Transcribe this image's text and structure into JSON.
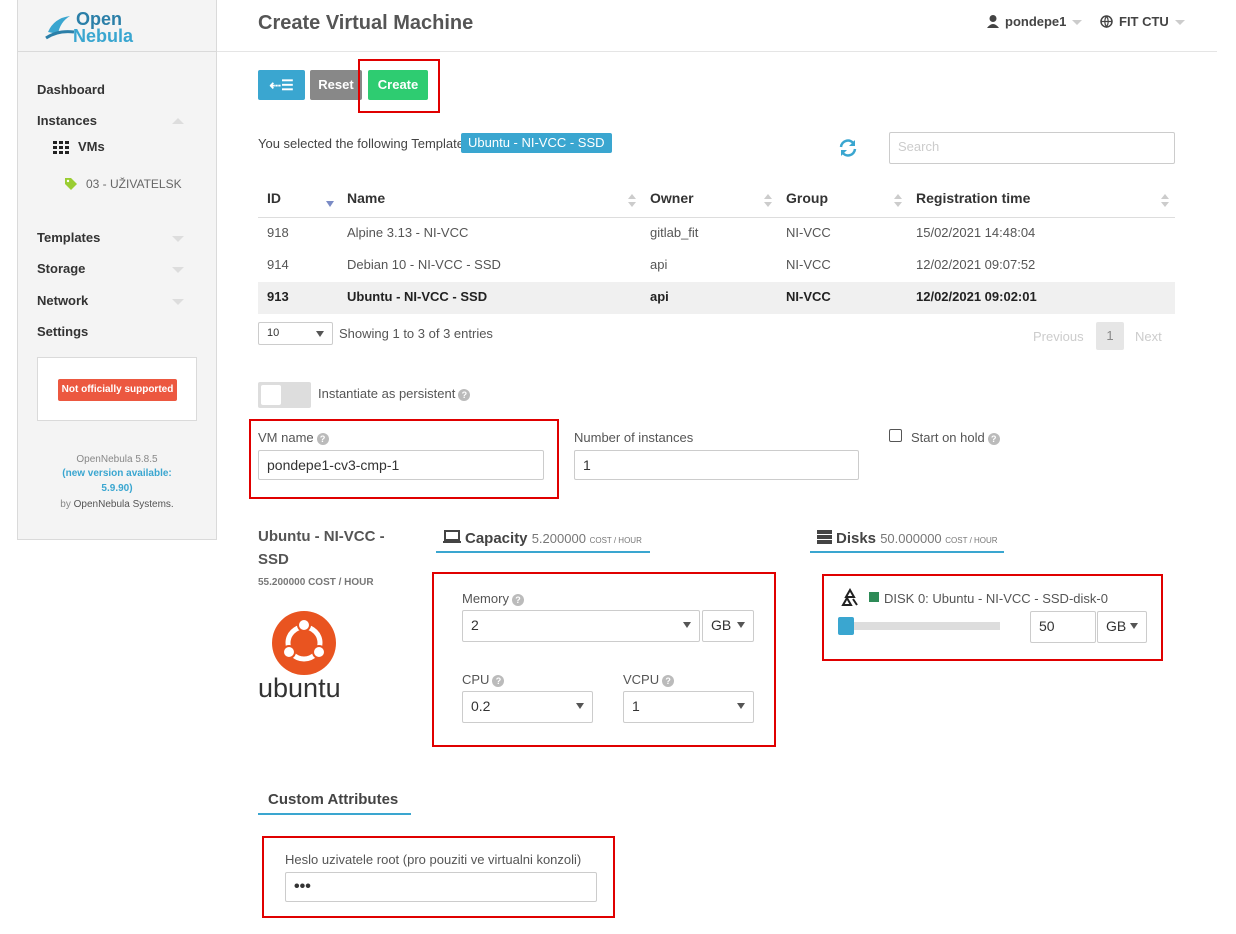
{
  "sidebar": {
    "logo_line1": "Open",
    "logo_line2": "Nebula",
    "items": [
      {
        "label": "Dashboard"
      },
      {
        "label": "Instances"
      },
      {
        "label": "VMs"
      },
      {
        "label": "03 - UŽIVATELSK"
      },
      {
        "label": "Templates"
      },
      {
        "label": "Storage"
      },
      {
        "label": "Network"
      },
      {
        "label": "Settings"
      }
    ],
    "support_badge": "Not officially supported",
    "version": "OpenNebula 5.8.5",
    "new_version_1": "(new version available:",
    "new_version_2": "5.9.90)",
    "by_prefix": "by",
    "by_company": "OpenNebula Systems."
  },
  "header": {
    "title": "Create Virtual Machine",
    "user": "pondepe1",
    "zone": "FIT CTU"
  },
  "toolbar": {
    "back_label": "⇠☰",
    "reset_label": "Reset",
    "create_label": "Create"
  },
  "template_select": {
    "prefix": "You selected the following Template:",
    "selected": "Ubuntu - NI-VCC - SSD",
    "search_placeholder": "Search"
  },
  "table": {
    "headers": [
      "ID",
      "Name",
      "Owner",
      "Group",
      "Registration time"
    ],
    "rows": [
      {
        "id": "918",
        "name": "Alpine 3.13 - NI-VCC",
        "owner": "gitlab_fit",
        "group": "NI-VCC",
        "time": "15/02/2021 14:48:04"
      },
      {
        "id": "914",
        "name": "Debian 10 - NI-VCC - SSD",
        "owner": "api",
        "group": "NI-VCC",
        "time": "12/02/2021 09:07:52"
      },
      {
        "id": "913",
        "name": "Ubuntu - NI-VCC - SSD",
        "owner": "api",
        "group": "NI-VCC",
        "time": "12/02/2021 09:02:01"
      }
    ],
    "page_length": "10",
    "info": "Showing 1 to 3 of 3 entries",
    "prev": "Previous",
    "page": "1",
    "next": "Next"
  },
  "form": {
    "persistent_label": "Instantiate as persistent",
    "vm_name_label": "VM name",
    "vm_name_value": "pondepe1-cv3-cmp-1",
    "instances_label": "Number of instances",
    "instances_value": "1",
    "hold_label": "Start on hold"
  },
  "template_info": {
    "name": "Ubuntu - NI-VCC - SSD",
    "cost": "55.200000",
    "cost_unit": "COST / HOUR",
    "logo_text": "ubuntu"
  },
  "capacity": {
    "title": "Capacity",
    "cost": "5.200000",
    "cost_unit": "COST / HOUR",
    "memory_label": "Memory",
    "memory_value": "2",
    "memory_unit": "GB",
    "cpu_label": "CPU",
    "cpu_value": "0.2",
    "vcpu_label": "VCPU",
    "vcpu_value": "1"
  },
  "disks": {
    "title": "Disks",
    "cost": "50.000000",
    "cost_unit": "COST / HOUR",
    "disk_label": "DISK 0: Ubuntu - NI-VCC - SSD-disk-0",
    "size_value": "50",
    "size_unit": "GB",
    "slider_fraction": 0.0
  },
  "custom": {
    "title": "Custom Attributes",
    "root_label": "Heslo uzivatele root (pro pouziti ve virtualni konzoli)",
    "root_value": "•••"
  },
  "colors": {
    "accent": "#3aa6d0",
    "create": "#2ecc71",
    "reset": "#888888",
    "badge": "#ec5840",
    "highlight": "#e00000"
  }
}
